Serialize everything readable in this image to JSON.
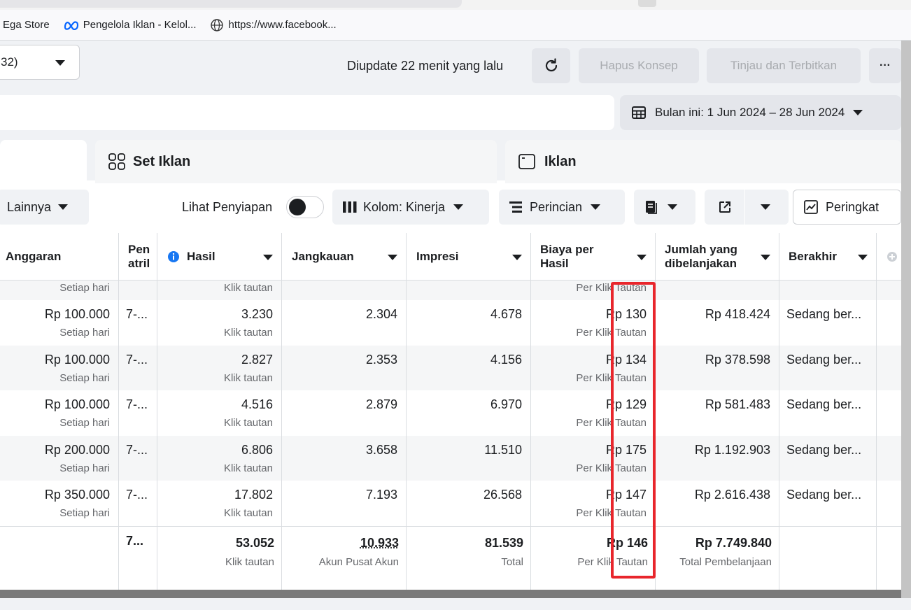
{
  "bookmarks": [
    {
      "label": "Ega Store",
      "icon": "none"
    },
    {
      "label": "Pengelola Iklan - Kelol...",
      "icon": "meta-icon"
    },
    {
      "label": "https://www.facebook...",
      "icon": "globe-icon"
    }
  ],
  "header": {
    "campaign_select_value": "32)",
    "updated_text": "Diupdate 22 menit yang lalu",
    "discard_label": "Hapus Konsep",
    "publish_label": "Tinjau dan Terbitkan",
    "more_label": "···",
    "date_range": "Bulan ini: 1 Jun 2024 – 28 Jun 2024"
  },
  "tabs": {
    "adset_label": "Set Iklan",
    "ad_label": "Iklan"
  },
  "toolbar": {
    "more_label": "Lainnya",
    "preview_label": "Lihat Penyiapan",
    "columns_label": "Kolom: Kinerja",
    "breakdown_label": "Perincian",
    "rank_label": "Peringkat"
  },
  "table": {
    "headers": {
      "budget": "Anggaran",
      "attribution_1": "Pen",
      "attribution_2": "atril",
      "results": "Hasil",
      "reach": "Jangkauan",
      "impressions": "Impresi",
      "cost_1": "Biaya per",
      "cost_2": "Hasil",
      "spent_1": "Jumlah yang",
      "spent_2": "dibelanjakan",
      "ends": "Berakhir"
    },
    "partial_row": {
      "budget_sub": "Setiap hari",
      "results_sub": "Klik tautan",
      "cost_sub": "Per Klik Tautan"
    },
    "rows": [
      {
        "budget": "Rp 100.000",
        "budget_sub": "Setiap hari",
        "attr": "7-...",
        "results": "3.230",
        "results_sub": "Klik tautan",
        "reach": "2.304",
        "impressions": "4.678",
        "cost": "Rp 130",
        "cost_sub": "Per Klik Tautan",
        "spent": "Rp 418.424",
        "ends": "Sedang ber..."
      },
      {
        "budget": "Rp 100.000",
        "budget_sub": "Setiap hari",
        "attr": "7-...",
        "results": "2.827",
        "results_sub": "Klik tautan",
        "reach": "2.353",
        "impressions": "4.156",
        "cost": "Rp 134",
        "cost_sub": "Per Klik Tautan",
        "spent": "Rp 378.598",
        "ends": "Sedang ber..."
      },
      {
        "budget": "Rp 100.000",
        "budget_sub": "Setiap hari",
        "attr": "7-...",
        "results": "4.516",
        "results_sub": "Klik tautan",
        "reach": "2.879",
        "impressions": "6.970",
        "cost": "Rp 129",
        "cost_sub": "Per Klik Tautan",
        "spent": "Rp 581.483",
        "ends": "Sedang ber..."
      },
      {
        "budget": "Rp 200.000",
        "budget_sub": "Setiap hari",
        "attr": "7-...",
        "results": "6.806",
        "results_sub": "Klik tautan",
        "reach": "3.658",
        "impressions": "11.510",
        "cost": "Rp 175",
        "cost_sub": "Per Klik Tautan",
        "spent": "Rp 1.192.903",
        "ends": "Sedang ber..."
      },
      {
        "budget": "Rp 350.000",
        "budget_sub": "Setiap hari",
        "attr": "7-...",
        "results": "17.802",
        "results_sub": "Klik tautan",
        "reach": "7.193",
        "impressions": "26.568",
        "cost": "Rp 147",
        "cost_sub": "Per Klik Tautan",
        "spent": "Rp 2.616.438",
        "ends": "Sedang ber..."
      }
    ],
    "totals": {
      "attr": "7...",
      "results": "53.052",
      "results_sub": "Klik tautan",
      "reach": "10.933",
      "reach_sub": "Akun Pusat Akun",
      "impressions": "81.539",
      "impressions_sub": "Total",
      "cost": "Rp 146",
      "cost_sub": "Per Klik Tautan",
      "spent": "Rp 7.749.840",
      "spent_sub": "Total Pembelanjaan"
    }
  },
  "colors": {
    "highlight": "#e8262c",
    "info_icon": "#1877f2"
  }
}
